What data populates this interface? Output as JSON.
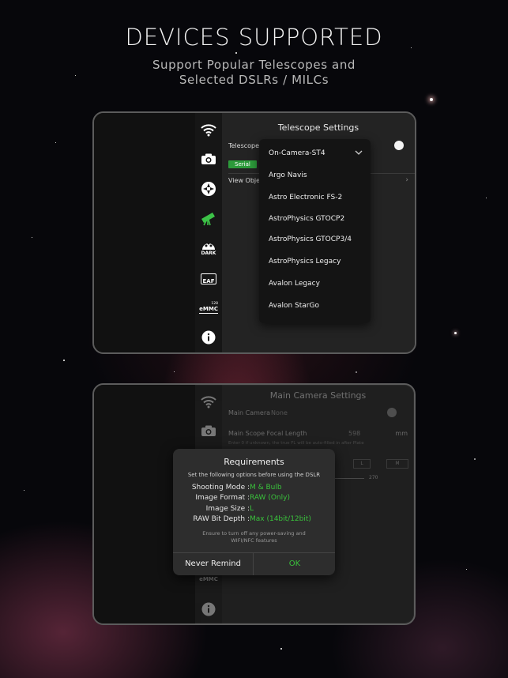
{
  "headline": "DEVICES SUPPORTED",
  "subheadline": {
    "line1": "Support Popular Telescopes and",
    "line2": "Selected DSLRs / MILCs"
  },
  "sidebar_icons": [
    "wifi-icon",
    "camera-icon",
    "focuser-icon",
    "telescope-icon",
    "dark-frame-icon",
    "eaf-icon",
    "emmc-storage-icon",
    "info-icon"
  ],
  "sidebar_labels": {
    "dark": "DARK",
    "eaf": "EAF",
    "emmc": "eMMC",
    "emmc_sup": "128"
  },
  "telescope_settings": {
    "title": "Telescope Settings",
    "telescope_label": "Telescope",
    "serial_tag": "Serial",
    "view_object_label": "View Objec",
    "dropdown": {
      "selected": "On-Camera-ST4",
      "options": [
        "Argo Navis",
        "Astro Electronic FS-2",
        "AstroPhysics GTOCP2",
        "AstroPhysics GTOCP3/4",
        "AstroPhysics Legacy",
        "Avalon Legacy",
        "Avalon StarGo"
      ]
    }
  },
  "camera_settings": {
    "title": "Main Camera Settings",
    "main_camera_label": "Main Camera",
    "main_camera_value": "None",
    "focal_length_label": "Main Scope Focal Length",
    "focal_length_value": "598",
    "focal_length_unit": "mm",
    "focal_hint": "Enter 0 if unknown, the true FL will be auto-filled in after Plate",
    "size_option_l": "L",
    "size_option_m": "M",
    "slider_value": "270"
  },
  "requirements_dialog": {
    "title": "Requirements",
    "subtitle": "Set the following options before using the DSLR",
    "rows": [
      {
        "key": "Shooting Mode :",
        "value": "M & Bulb"
      },
      {
        "key": "Image Format :",
        "value": "RAW (Only)"
      },
      {
        "key": "Image Size :",
        "value": "L"
      },
      {
        "key": "RAW Bit Depth :",
        "value": "Max (14bit/12bit)"
      }
    ],
    "note_line1": "Ensure to turn off any power-saving and",
    "note_line2": "WIFI/NFC features",
    "never_remind_label": "Never Remind",
    "ok_label": "OK"
  },
  "colors": {
    "accent_green": "#39c13b",
    "serial_green": "#2c9a3a",
    "telescope_icon_green": "#3cc247",
    "background": "#07070b"
  }
}
